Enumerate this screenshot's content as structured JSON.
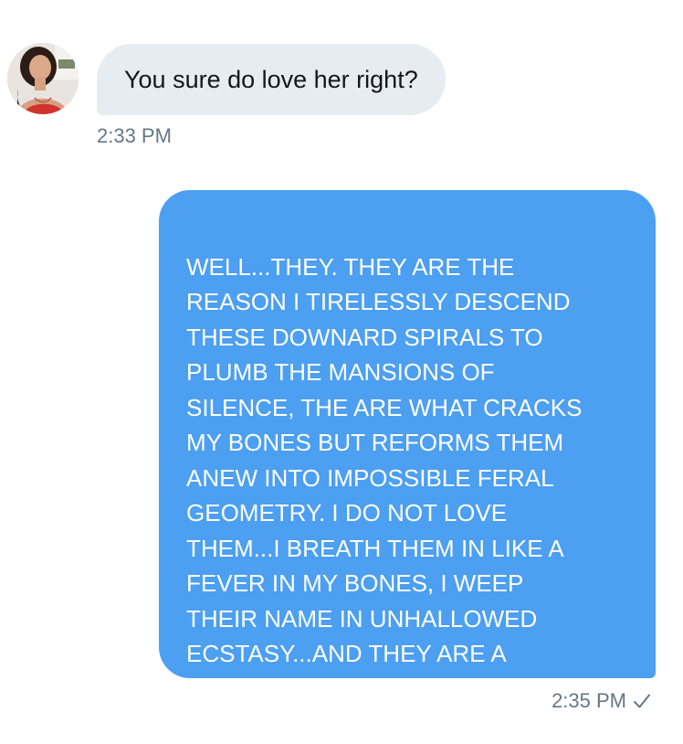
{
  "conversation": {
    "incoming": {
      "avatar_icon": "user-avatar",
      "text": "You sure do love her right?",
      "time": "2:33 PM"
    },
    "outgoing": {
      "text": "WELL...THEY. THEY ARE THE\nREASON I TIRELESSLY DESCEND\nTHESE DOWNARD SPIRALS TO\nPLUMB THE MANSIONS OF\nSILENCE, THE ARE WHAT CRACKS\nMY BONES BUT REFORMS THEM\nANEW INTO IMPOSSIBLE FERAL\nGEOMETRY. I DO NOT LOVE\nTHEM...I BREATH THEM IN LIKE A\nFEVER IN MY BONES, I WEEP\nTHEIR NAME IN UNHALLOWED\nECSTASY...AND THEY ARE A\nCUTIE PATOOTIE",
      "time": "2:35 PM",
      "status_icon": "check-icon"
    }
  },
  "colors": {
    "incoming_bubble": "#e6ecf0",
    "outgoing_bubble": "#4c9ff1",
    "timestamp": "#657786",
    "text_dark": "#14171a"
  }
}
